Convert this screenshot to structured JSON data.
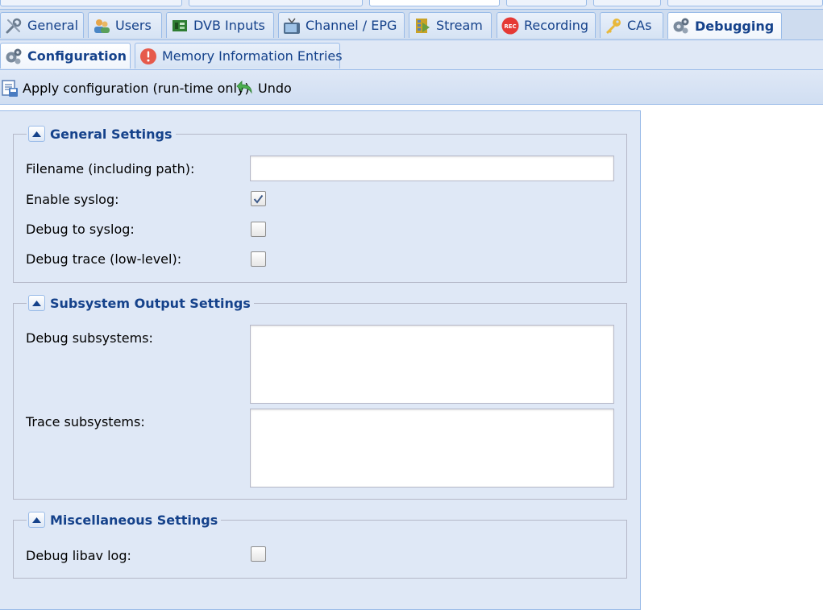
{
  "main_tabs": [
    {
      "label": "General",
      "icon": "wrench-icon"
    },
    {
      "label": "Users",
      "icon": "users-icon"
    },
    {
      "label": "DVB Inputs",
      "icon": "dvb-card-icon"
    },
    {
      "label": "Channel / EPG",
      "icon": "tv-icon"
    },
    {
      "label": "Stream",
      "icon": "stream-icon"
    },
    {
      "label": "Recording",
      "icon": "rec-icon"
    },
    {
      "label": "CAs",
      "icon": "key-icon"
    },
    {
      "label": "Debugging",
      "icon": "gears-icon",
      "active": true
    }
  ],
  "sub_tabs": [
    {
      "label": "Configuration",
      "icon": "gears-icon",
      "active": true
    },
    {
      "label": "Memory Information Entries",
      "icon": "warning-icon"
    }
  ],
  "toolbar": {
    "apply_label": "Apply configuration (run-time only)",
    "undo_label": "Undo"
  },
  "general_settings": {
    "title": "General Settings",
    "filename_label": "Filename (including path):",
    "filename_value": "",
    "enable_syslog_label": "Enable syslog:",
    "enable_syslog_checked": true,
    "debug_syslog_label": "Debug to syslog:",
    "debug_syslog_checked": false,
    "debug_trace_label": "Debug trace (low-level):",
    "debug_trace_checked": false
  },
  "subsystem_settings": {
    "title": "Subsystem Output Settings",
    "debug_subsystems_label": "Debug subsystems:",
    "debug_subsystems_value": "",
    "trace_subsystems_label": "Trace subsystems:",
    "trace_subsystems_value": ""
  },
  "misc_settings": {
    "title": "Miscellaneous Settings",
    "libav_log_label": "Debug libav log:",
    "libav_log_checked": false
  },
  "colors": {
    "accent": "#15428b",
    "border": "#99bbe8",
    "panel_bg": "#dfe8f6"
  }
}
